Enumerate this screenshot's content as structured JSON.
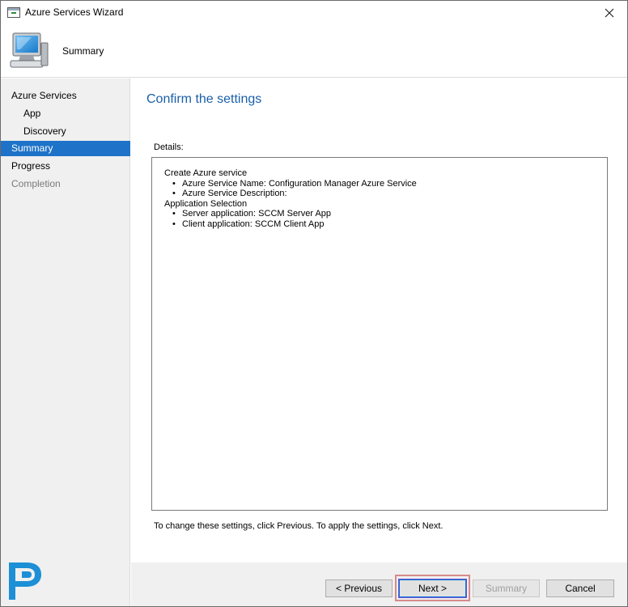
{
  "window": {
    "title": "Azure Services Wizard",
    "icon": "wizard-window-icon"
  },
  "header": {
    "title": "Summary",
    "icon": "computer-icon"
  },
  "nav": {
    "items": [
      {
        "label": "Azure Services",
        "state": "normal"
      },
      {
        "label": "App",
        "state": "normal"
      },
      {
        "label": "Discovery",
        "state": "normal"
      },
      {
        "label": "Summary",
        "state": "active"
      },
      {
        "label": "Progress",
        "state": "normal"
      },
      {
        "label": "Completion",
        "state": "disabled"
      }
    ]
  },
  "content": {
    "title": "Confirm the settings",
    "details_label": "Details:",
    "details": {
      "section1_title": "Create Azure service",
      "section1_items": [
        "Azure Service Name: Configuration Manager Azure Service",
        "Azure Service Description:"
      ],
      "section2_title": "Application Selection",
      "section2_items": [
        "Server application: SCCM Server App",
        "Client application: SCCM Client App"
      ]
    },
    "hint": "To change these settings, click Previous. To apply the settings, click Next."
  },
  "buttons": {
    "previous": "< Previous",
    "next": "Next >",
    "summary": "Summary",
    "cancel": "Cancel"
  },
  "colors": {
    "accent": "#1e73c8",
    "title_blue": "#1a5fa8",
    "panel_gray": "#f0f0f0",
    "highlight": "#d58a8a"
  }
}
